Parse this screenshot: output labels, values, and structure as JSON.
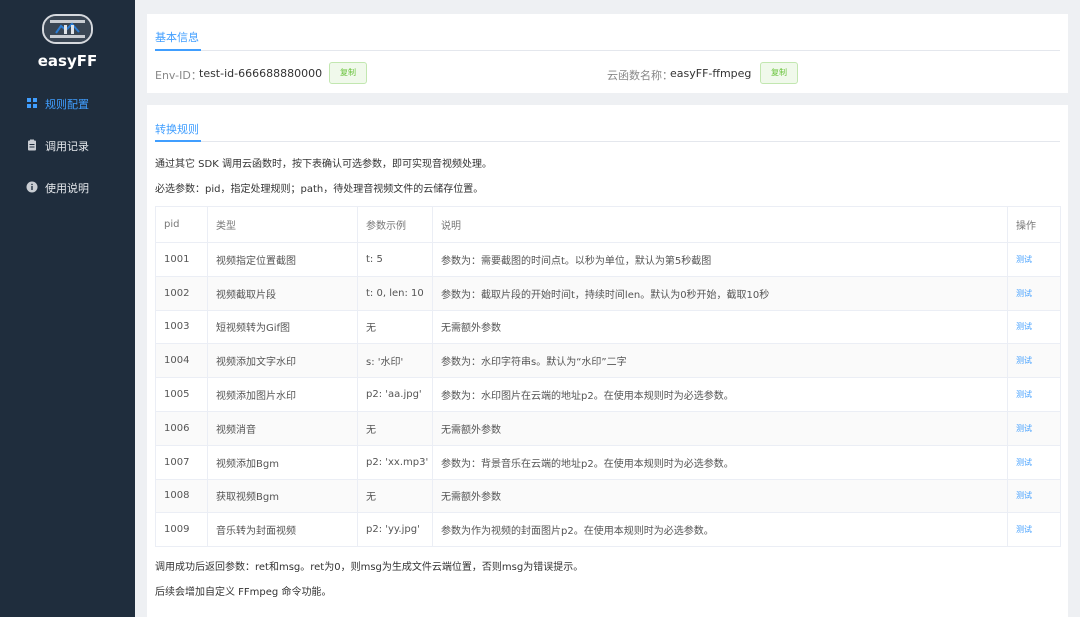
{
  "app": {
    "brand": "easyFF"
  },
  "sidebar": {
    "items": [
      {
        "label": "规则配置",
        "icon": "grid-icon",
        "active": true
      },
      {
        "label": "调用记录",
        "icon": "clipboard-icon",
        "active": false
      },
      {
        "label": "使用说明",
        "icon": "info-icon",
        "active": false
      }
    ]
  },
  "basic": {
    "title": "基本信息",
    "env_label": "Env-ID：",
    "env_value": "test-id-666688880000",
    "func_label": "云函数名称：",
    "func_value": "easyFF-ffmpeg",
    "copy_label": "复制"
  },
  "rules": {
    "title": "转换规则",
    "intro": "通过其它 SDK 调用云函数时，按下表确认可选参数，即可实现音视频处理。",
    "required": "必选参数：pid，指定处理规则；path，待处理音视频文件的云储存位置。",
    "columns": [
      "pid",
      "类型",
      "参数示例",
      "说明",
      "操作"
    ],
    "action_label": "测试",
    "rows": [
      {
        "pid": "1001",
        "type": "视频指定位置截图",
        "example": "t: 5",
        "desc": "参数为：需要截图的时间点t。以秒为单位，默认为第5秒截图"
      },
      {
        "pid": "1002",
        "type": "视频截取片段",
        "example": "t: 0, len: 10",
        "desc": "参数为：截取片段的开始时间t，持续时间len。默认为0秒开始，截取10秒"
      },
      {
        "pid": "1003",
        "type": "短视频转为Gif图",
        "example": "无",
        "desc": "无需额外参数"
      },
      {
        "pid": "1004",
        "type": "视频添加文字水印",
        "example": "s: '水印'",
        "desc": "参数为：水印字符串s。默认为“水印”二字"
      },
      {
        "pid": "1005",
        "type": "视频添加图片水印",
        "example": "p2: 'aa.jpg'",
        "desc": "参数为：水印图片在云端的地址p2。在使用本规则时为必选参数。"
      },
      {
        "pid": "1006",
        "type": "视频消音",
        "example": "无",
        "desc": "无需额外参数"
      },
      {
        "pid": "1007",
        "type": "视频添加Bgm",
        "example": "p2: 'xx.mp3'",
        "desc": "参数为：背景音乐在云端的地址p2。在使用本规则时为必选参数。"
      },
      {
        "pid": "1008",
        "type": "获取视频Bgm",
        "example": "无",
        "desc": "无需额外参数"
      },
      {
        "pid": "1009",
        "type": "音乐转为封面视频",
        "example": "p2: 'yy.jpg'",
        "desc": "参数为作为视频的封面图片p2。在使用本规则时为必选参数。"
      }
    ],
    "footer_return": "调用成功后返回参数：ret和msg。ret为0，则msg为生成文件云端位置，否则msg为错误提示。",
    "footer_future": "后续会增加自定义 FFmpeg 命令功能。"
  },
  "colors": {
    "sidebar_bg": "#1f2d3d",
    "accent": "#409eff",
    "copy_green": "#67c23a"
  }
}
